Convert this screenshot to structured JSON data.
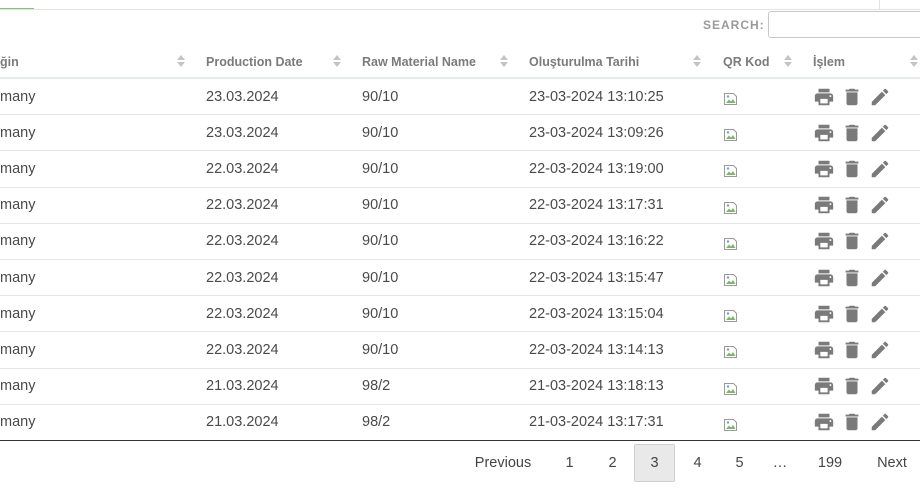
{
  "search": {
    "label": "SEARCH:",
    "value": ""
  },
  "columns": [
    {
      "label": "ğin"
    },
    {
      "label": "Production Date"
    },
    {
      "label": "Raw Material Name"
    },
    {
      "label": "Oluşturulma Tarihi"
    },
    {
      "label": "QR Kod"
    },
    {
      "label": "İşlem"
    }
  ],
  "rows": [
    {
      "origin": "many",
      "production_date": "23.03.2024",
      "raw_material": "90/10",
      "created_at": "23-03-2024 13:10:25"
    },
    {
      "origin": "many",
      "production_date": "23.03.2024",
      "raw_material": "90/10",
      "created_at": "23-03-2024 13:09:26"
    },
    {
      "origin": "many",
      "production_date": "22.03.2024",
      "raw_material": "90/10",
      "created_at": "22-03-2024 13:19:00"
    },
    {
      "origin": "many",
      "production_date": "22.03.2024",
      "raw_material": "90/10",
      "created_at": "22-03-2024 13:17:31"
    },
    {
      "origin": "many",
      "production_date": "22.03.2024",
      "raw_material": "90/10",
      "created_at": "22-03-2024 13:16:22"
    },
    {
      "origin": "many",
      "production_date": "22.03.2024",
      "raw_material": "90/10",
      "created_at": "22-03-2024 13:15:47"
    },
    {
      "origin": "many",
      "production_date": "22.03.2024",
      "raw_material": "90/10",
      "created_at": "22-03-2024 13:15:04"
    },
    {
      "origin": "many",
      "production_date": "22.03.2024",
      "raw_material": "90/10",
      "created_at": "22-03-2024 13:14:13"
    },
    {
      "origin": "many",
      "production_date": "21.03.2024",
      "raw_material": "98/2",
      "created_at": "21-03-2024 13:18:13"
    },
    {
      "origin": "many",
      "production_date": "21.03.2024",
      "raw_material": "98/2",
      "created_at": "21-03-2024 13:17:31"
    }
  ],
  "row_icons": [
    "broken-image-icon",
    "print-icon",
    "trash-icon",
    "pencil-icon"
  ],
  "pagination": {
    "previous": "Previous",
    "next": "Next",
    "pages": [
      "1",
      "2",
      "3",
      "4",
      "5",
      "…",
      "199"
    ],
    "current": "3"
  },
  "colors": {
    "accent": "#7cc47a",
    "icon": "#7a7a7a",
    "text": "#4a4a4a"
  }
}
